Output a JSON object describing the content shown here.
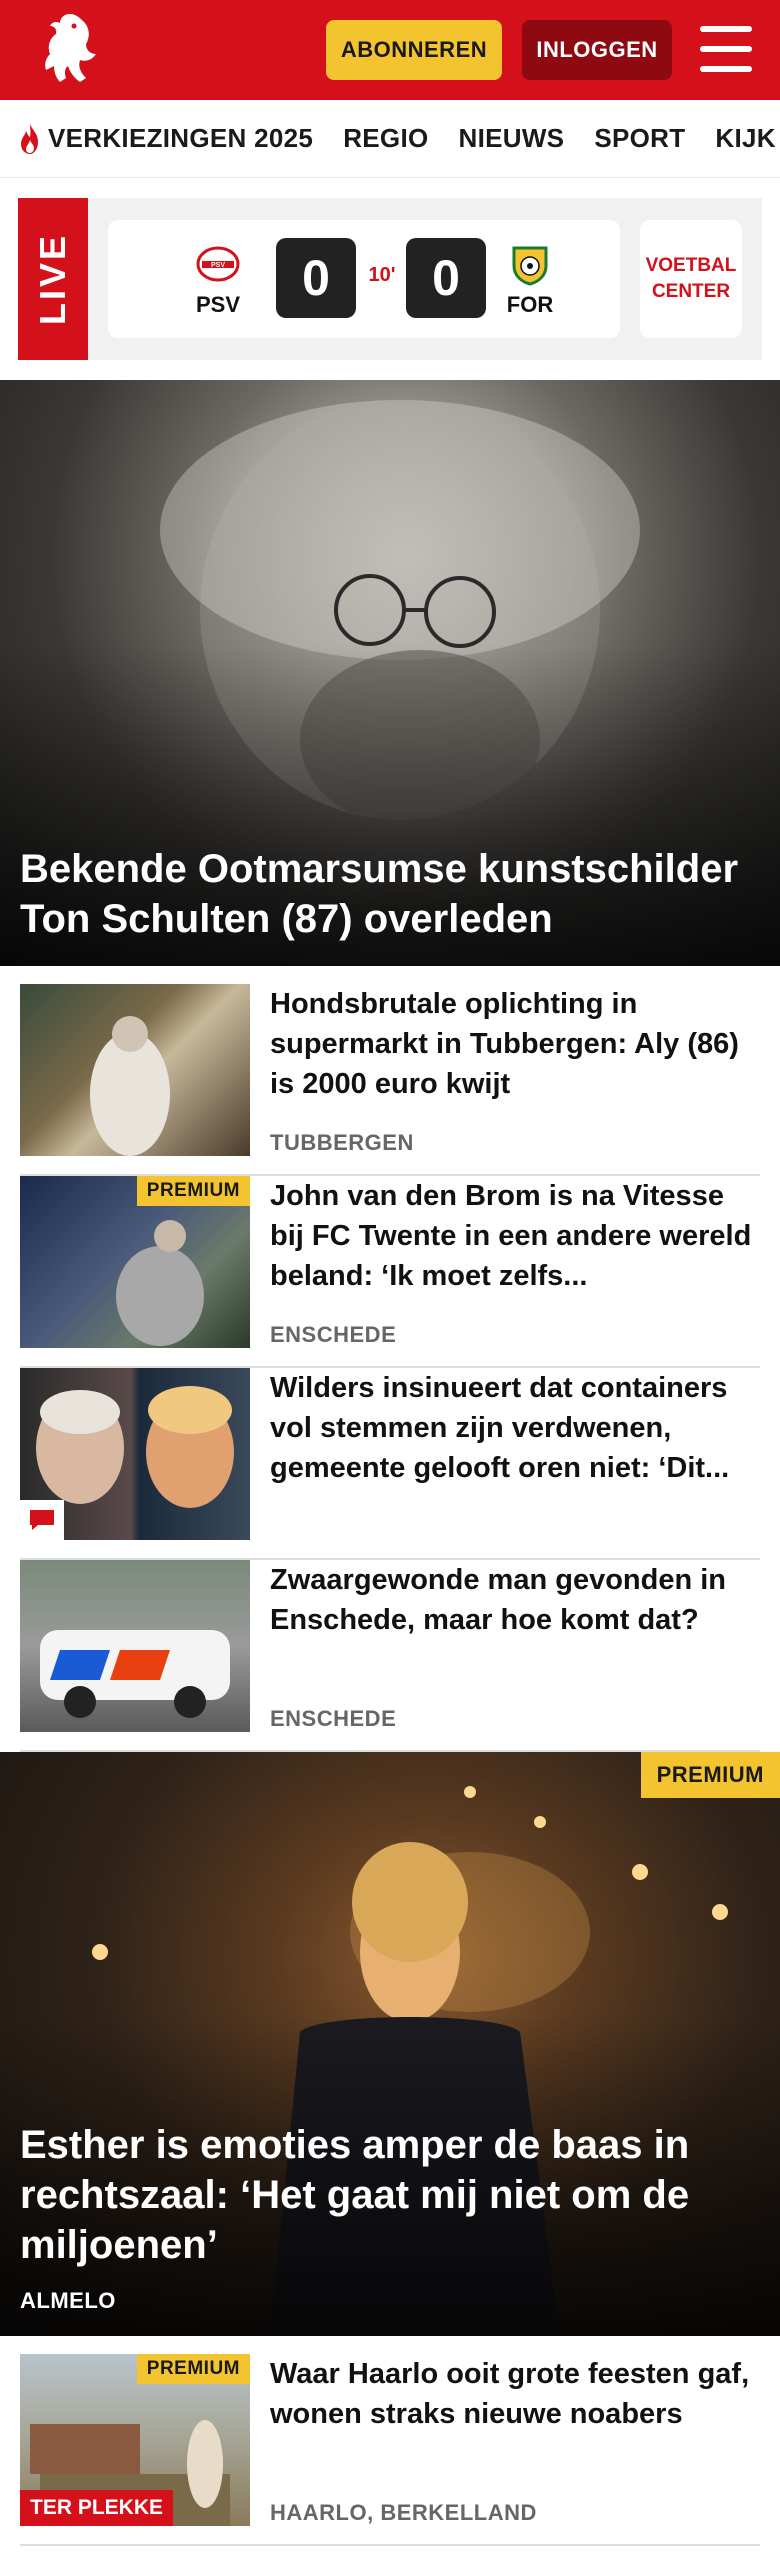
{
  "header": {
    "subscribe_label": "ABONNEREN",
    "login_label": "INLOGGEN",
    "brand_color": "#d4101a"
  },
  "nav": {
    "items": [
      {
        "label": "VERKIEZINGEN 2025",
        "icon": "flame-icon"
      },
      {
        "label": "REGIO"
      },
      {
        "label": "NIEUWS"
      },
      {
        "label": "SPORT"
      },
      {
        "label": "KIJK"
      }
    ]
  },
  "live": {
    "tag": "LIVE",
    "home_team": "PSV",
    "away_team": "FOR",
    "home_score": "0",
    "away_score": "0",
    "minute": "10'",
    "voetbalcenter_line1": "VOETBAL",
    "voetbalcenter_line2": "CENTER"
  },
  "hero1": {
    "title": "Bekende Ootmarsumse kunstschilder Ton Schulten (87) overleden"
  },
  "articles": [
    {
      "title": "Hondsbrutale oplichting in supermarkt in Tubbergen: Aly (86) is 2000 euro kwijt",
      "meta": "TUBBERGEN"
    },
    {
      "title": "John van den Brom is na Vitesse bij FC Twente in een andere wereld beland: ‘Ik moet zelfs...",
      "meta": "ENSCHEDE",
      "badge": "PREMIUM"
    },
    {
      "title": "Wilders insinueert dat containers vol stemmen zijn verdwenen, gemeente gelooft oren niet: ‘Dit...",
      "meta": ""
    },
    {
      "title": "Zwaargewonde man gevonden in Enschede, maar hoe komt dat?",
      "meta": "ENSCHEDE"
    },
    {
      "title": "Waar Haarlo ooit grote feesten gaf, wonen straks nieuwe noabers",
      "meta": "HAARLO, BERKELLAND",
      "badge": "PREMIUM",
      "tag": "TER PLEKKE"
    }
  ],
  "hero2": {
    "badge": "PREMIUM",
    "title": "Esther is emoties amper de baas in rechtszaal: ‘Het gaat mij niet om de miljoenen’",
    "meta": "ALMELO"
  }
}
